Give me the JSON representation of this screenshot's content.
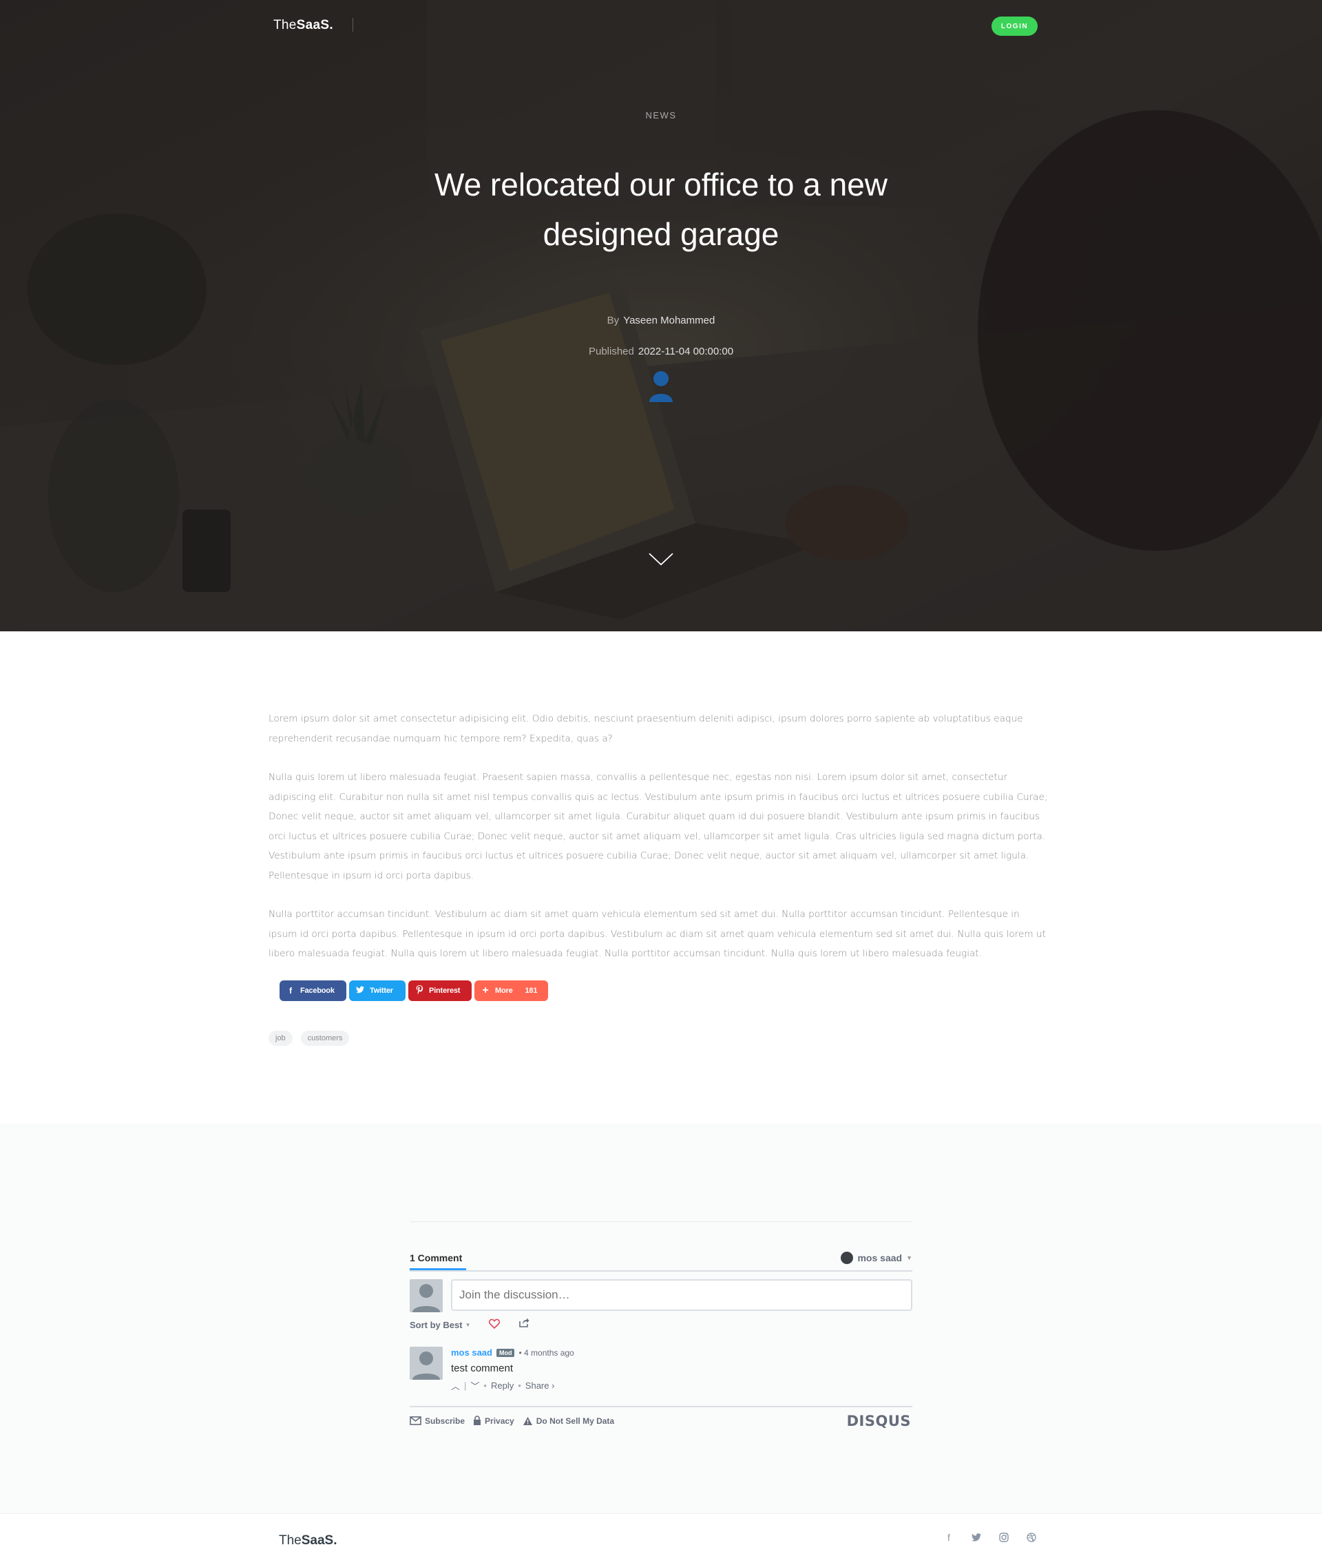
{
  "brand": {
    "prefix": "The",
    "bold": "SaaS."
  },
  "nav": {
    "login_label": "LOGIN"
  },
  "hero": {
    "category": "NEWS",
    "title": "We relocated our office to a new designed garage",
    "by_label": "By",
    "author": "Yaseen Mohammed",
    "published_label": "Published",
    "published_date": "2022-11-04 00:00:00"
  },
  "article": {
    "paragraphs": [
      "Lorem ipsum dolor sit amet consectetur adipisicing elit. Odio debitis, nesciunt praesentium deleniti adipisci, ipsum dolores porro sapiente ab voluptatibus eaque reprehenderit recusandae numquam hic tempore rem? Expedita, quas a?",
      "Nulla quis lorem ut libero malesuada feugiat. Praesent sapien massa, convallis a pellentesque nec, egestas non nisi. Lorem ipsum dolor sit amet, consectetur adipiscing elit. Curabitur non nulla sit amet nisl tempus convallis quis ac lectus. Vestibulum ante ipsum primis in faucibus orci luctus et ultrices posuere cubilia Curae; Donec velit neque, auctor sit amet aliquam vel, ullamcorper sit amet ligula. Curabitur aliquet quam id dui posuere blandit. Vestibulum ante ipsum primis in faucibus orci luctus et ultrices posuere cubilia Curae; Donec velit neque, auctor sit amet aliquam vel, ullamcorper sit amet ligula. Cras ultricies ligula sed magna dictum porta. Vestibulum ante ipsum primis in faucibus orci luctus et ultrices posuere cubilia Curae; Donec velit neque, auctor sit amet aliquam vel, ullamcorper sit amet ligula. Pellentesque in ipsum id orci porta dapibus.",
      "Nulla porttitor accumsan tincidunt. Vestibulum ac diam sit amet quam vehicula elementum sed sit amet dui. Nulla porttitor accumsan tincidunt. Pellentesque in ipsum id orci porta dapibus. Pellentesque in ipsum id orci porta dapibus. Vestibulum ac diam sit amet quam vehicula elementum sed sit amet dui. Nulla quis lorem ut libero malesuada feugiat. Nulla quis lorem ut libero malesuada feugiat. Nulla porttitor accumsan tincidunt. Nulla quis lorem ut libero malesuada feugiat."
    ]
  },
  "share": {
    "facebook": "Facebook",
    "twitter": "Twitter",
    "pinterest": "Pinterest",
    "more": "More",
    "more_count": "181",
    "colors": {
      "facebook": "#3b5998",
      "twitter": "#1da1f2",
      "pinterest": "#cb2027",
      "more": "#ff6550"
    }
  },
  "tags": [
    "job",
    "customers"
  ],
  "disqus": {
    "comment_count": "1 Comment",
    "user": "mos saad",
    "input_placeholder": "Join the discussion…",
    "sort_label": "Sort by Best",
    "comment": {
      "author": "mos saad",
      "badge": "Mod",
      "time": "• 4 months ago",
      "text": "test comment",
      "reply": "Reply",
      "share": "Share ›"
    },
    "footer": {
      "subscribe": "Subscribe",
      "privacy": "Privacy",
      "do_not_sell": "Do Not Sell My Data",
      "logo": "DISQUS"
    }
  },
  "footer": {
    "social_icons": [
      "facebook-icon",
      "twitter-icon",
      "instagram-icon",
      "dribbble-icon"
    ]
  },
  "colors": {
    "accent_green": "#3cd458",
    "disqus_blue": "#2e9fff"
  }
}
